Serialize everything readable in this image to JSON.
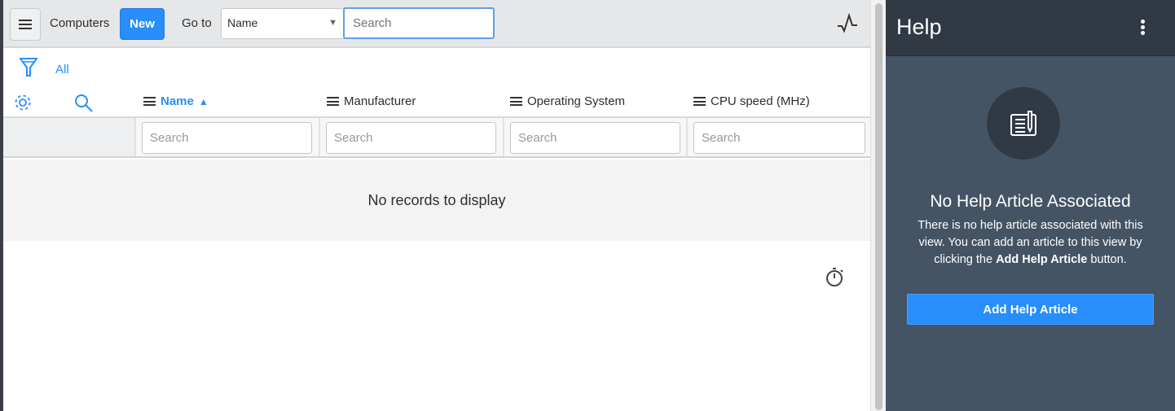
{
  "toolbar": {
    "title": "Computers",
    "new_label": "New",
    "goto_label": "Go to",
    "goto_field": "Name",
    "search_placeholder": "Search"
  },
  "filter": {
    "label": "All"
  },
  "columns": [
    {
      "label": "Name",
      "sorted": "ascending",
      "search_placeholder": "Search"
    },
    {
      "label": "Manufacturer",
      "search_placeholder": "Search"
    },
    {
      "label": "Operating System",
      "search_placeholder": "Search"
    },
    {
      "label": "CPU speed (MHz)",
      "search_placeholder": "Search"
    }
  ],
  "empty_message": "No records to display",
  "help": {
    "title": "Help",
    "heading": "No Help Article Associated",
    "text_before": "There is no help article associated with this view. You can add an article to this view by clicking the ",
    "text_bold": "Add Help Article",
    "text_after": " button.",
    "button": "Add Help Article"
  },
  "colors": {
    "accent": "#278efc",
    "help_bg": "#445464",
    "help_header": "#313944"
  }
}
